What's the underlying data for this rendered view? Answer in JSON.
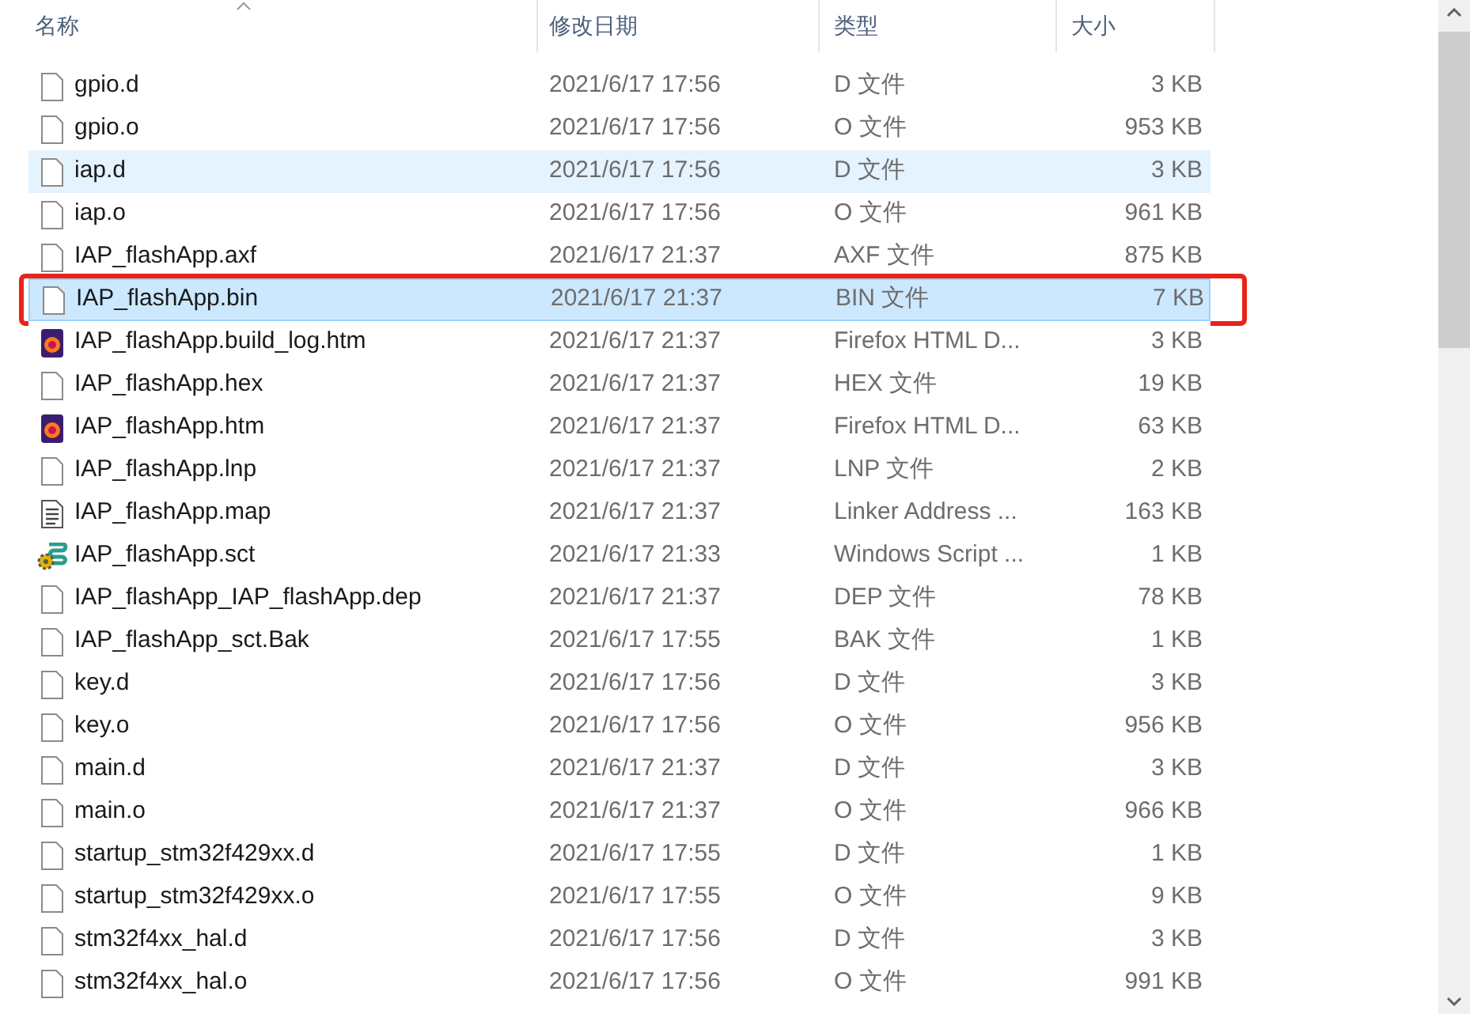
{
  "columns": [
    {
      "label": "名称",
      "sorted": true
    },
    {
      "label": "修改日期",
      "sorted": false
    },
    {
      "label": "类型",
      "sorted": false
    },
    {
      "label": "大小",
      "sorted": false
    }
  ],
  "files": [
    {
      "name": "gpio.d",
      "date": "2021/6/17 17:56",
      "type": "D 文件",
      "size": "3 KB",
      "kind": "file",
      "selected": false,
      "hovered": false,
      "annotated": false
    },
    {
      "name": "gpio.o",
      "date": "2021/6/17 17:56",
      "type": "O 文件",
      "size": "953 KB",
      "kind": "file",
      "selected": false,
      "hovered": false,
      "annotated": false
    },
    {
      "name": "iap.d",
      "date": "2021/6/17 17:56",
      "type": "D 文件",
      "size": "3 KB",
      "kind": "file",
      "selected": false,
      "hovered": true,
      "annotated": false
    },
    {
      "name": "iap.o",
      "date": "2021/6/17 17:56",
      "type": "O 文件",
      "size": "961 KB",
      "kind": "file",
      "selected": false,
      "hovered": false,
      "annotated": false
    },
    {
      "name": "IAP_flashApp.axf",
      "date": "2021/6/17 21:37",
      "type": "AXF 文件",
      "size": "875 KB",
      "kind": "file",
      "selected": false,
      "hovered": false,
      "annotated": false
    },
    {
      "name": "IAP_flashApp.bin",
      "date": "2021/6/17 21:37",
      "type": "BIN 文件",
      "size": "7 KB",
      "kind": "file",
      "selected": true,
      "hovered": false,
      "annotated": true
    },
    {
      "name": "IAP_flashApp.build_log.htm",
      "date": "2021/6/17 21:37",
      "type": "Firefox HTML D...",
      "size": "3 KB",
      "kind": "browser",
      "selected": false,
      "hovered": false,
      "annotated": false
    },
    {
      "name": "IAP_flashApp.hex",
      "date": "2021/6/17 21:37",
      "type": "HEX 文件",
      "size": "19 KB",
      "kind": "file",
      "selected": false,
      "hovered": false,
      "annotated": false
    },
    {
      "name": "IAP_flashApp.htm",
      "date": "2021/6/17 21:37",
      "type": "Firefox HTML D...",
      "size": "63 KB",
      "kind": "browser",
      "selected": false,
      "hovered": false,
      "annotated": false
    },
    {
      "name": "IAP_flashApp.lnp",
      "date": "2021/6/17 21:37",
      "type": "LNP 文件",
      "size": "2 KB",
      "kind": "file",
      "selected": false,
      "hovered": false,
      "annotated": false
    },
    {
      "name": "IAP_flashApp.map",
      "date": "2021/6/17 21:37",
      "type": "Linker Address ...",
      "size": "163 KB",
      "kind": "text",
      "selected": false,
      "hovered": false,
      "annotated": false
    },
    {
      "name": "IAP_flashApp.sct",
      "date": "2021/6/17 21:33",
      "type": "Windows Script ...",
      "size": "1 KB",
      "kind": "script",
      "selected": false,
      "hovered": false,
      "annotated": false
    },
    {
      "name": "IAP_flashApp_IAP_flashApp.dep",
      "date": "2021/6/17 21:37",
      "type": "DEP 文件",
      "size": "78 KB",
      "kind": "file",
      "selected": false,
      "hovered": false,
      "annotated": false
    },
    {
      "name": "IAP_flashApp_sct.Bak",
      "date": "2021/6/17 17:55",
      "type": "BAK 文件",
      "size": "1 KB",
      "kind": "file",
      "selected": false,
      "hovered": false,
      "annotated": false
    },
    {
      "name": "key.d",
      "date": "2021/6/17 17:56",
      "type": "D 文件",
      "size": "3 KB",
      "kind": "file",
      "selected": false,
      "hovered": false,
      "annotated": false
    },
    {
      "name": "key.o",
      "date": "2021/6/17 17:56",
      "type": "O 文件",
      "size": "956 KB",
      "kind": "file",
      "selected": false,
      "hovered": false,
      "annotated": false
    },
    {
      "name": "main.d",
      "date": "2021/6/17 21:37",
      "type": "D 文件",
      "size": "3 KB",
      "kind": "file",
      "selected": false,
      "hovered": false,
      "annotated": false
    },
    {
      "name": "main.o",
      "date": "2021/6/17 21:37",
      "type": "O 文件",
      "size": "966 KB",
      "kind": "file",
      "selected": false,
      "hovered": false,
      "annotated": false
    },
    {
      "name": "startup_stm32f429xx.d",
      "date": "2021/6/17 17:55",
      "type": "D 文件",
      "size": "1 KB",
      "kind": "file",
      "selected": false,
      "hovered": false,
      "annotated": false
    },
    {
      "name": "startup_stm32f429xx.o",
      "date": "2021/6/17 17:55",
      "type": "O 文件",
      "size": "9 KB",
      "kind": "file",
      "selected": false,
      "hovered": false,
      "annotated": false
    },
    {
      "name": "stm32f4xx_hal.d",
      "date": "2021/6/17 17:56",
      "type": "D 文件",
      "size": "3 KB",
      "kind": "file",
      "selected": false,
      "hovered": false,
      "annotated": false
    },
    {
      "name": "stm32f4xx_hal.o",
      "date": "2021/6/17 17:56",
      "type": "O 文件",
      "size": "991 KB",
      "kind": "file",
      "selected": false,
      "hovered": false,
      "annotated": false
    }
  ]
}
